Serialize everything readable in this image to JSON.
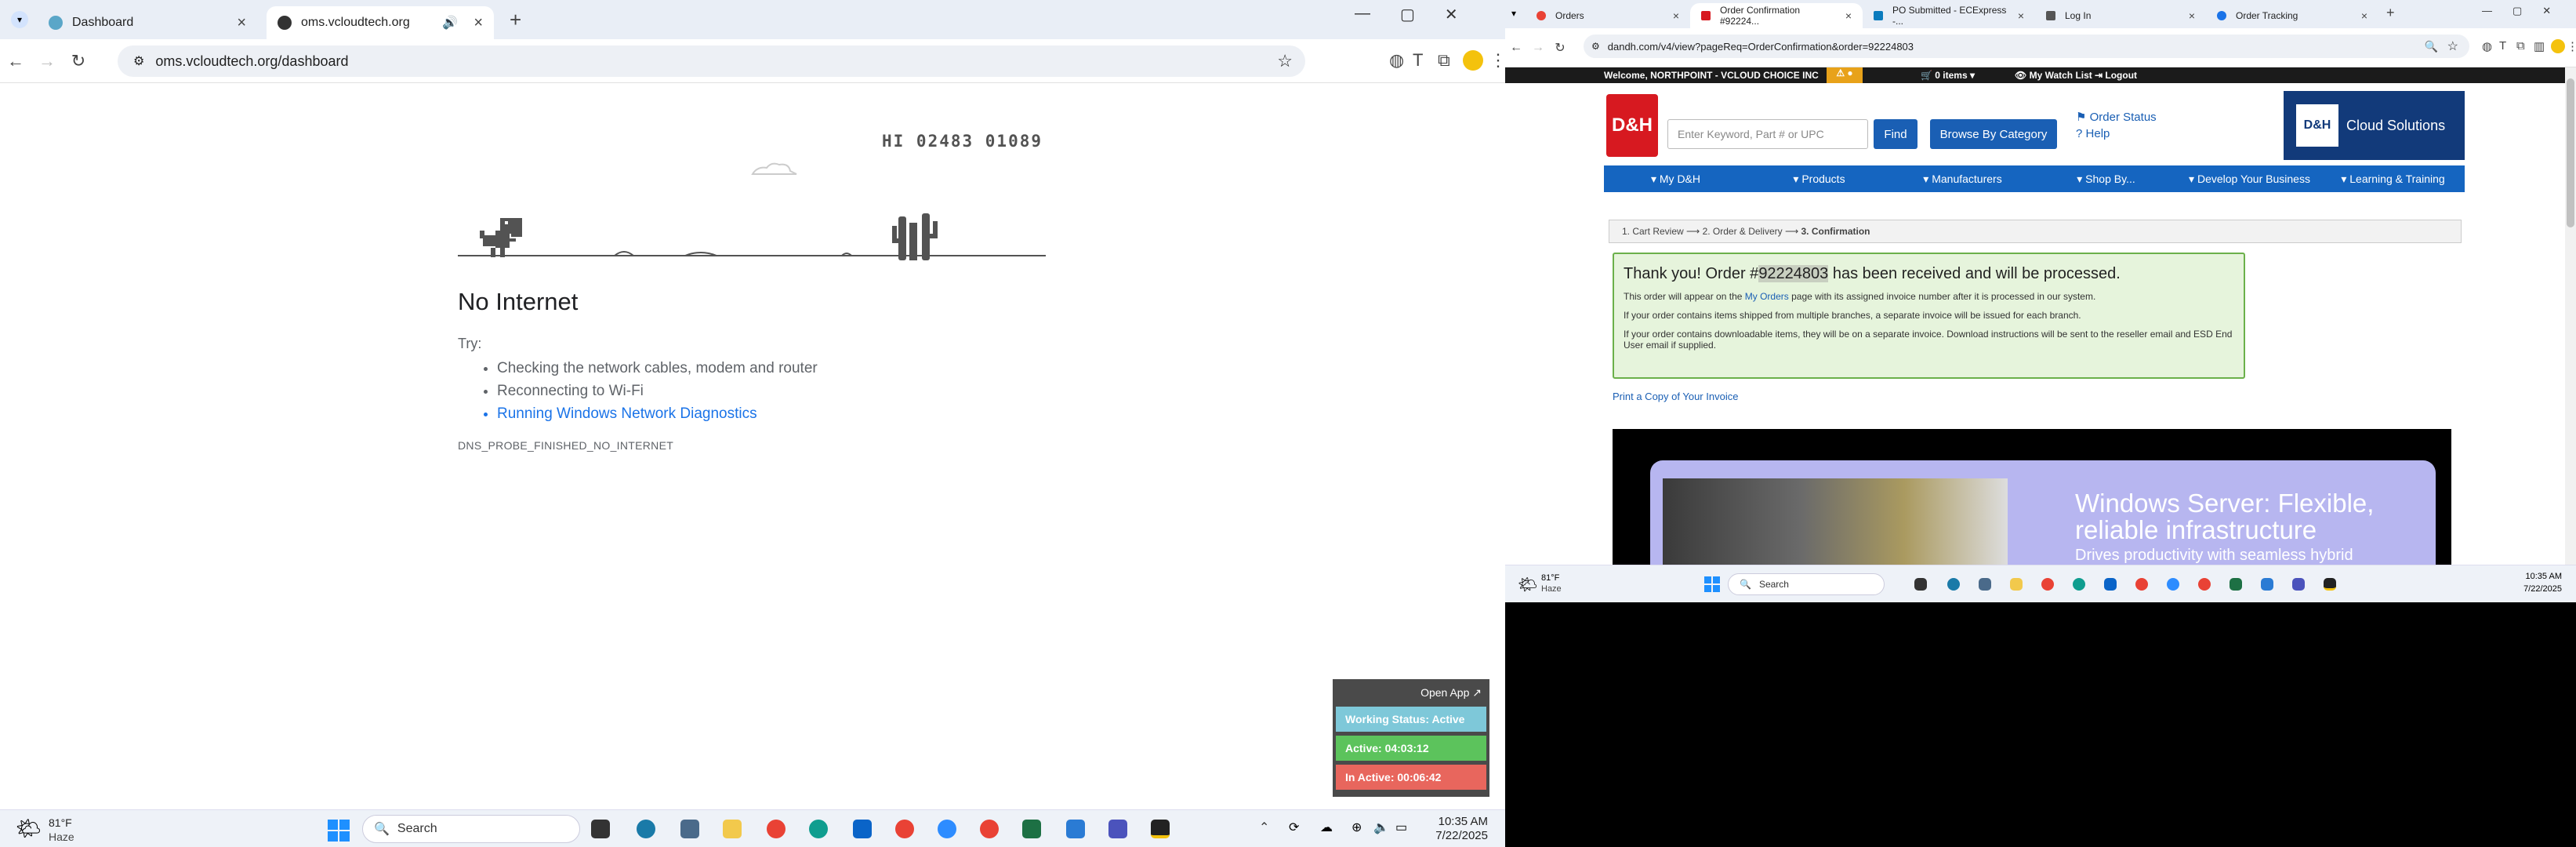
{
  "left_window": {
    "tabs": [
      {
        "label": "Dashboard",
        "active": false
      },
      {
        "label": "oms.vcloudtech.org",
        "active": true
      }
    ],
    "url": "oms.vcloudtech.org/dashboard",
    "dino": {
      "score": "HI 02483 01089"
    },
    "error": {
      "title": "No Internet",
      "try_label": "Try:",
      "tips": [
        "Checking the network cables, modem and router",
        "Reconnecting to Wi-Fi",
        "Running Windows Network Diagnostics"
      ],
      "code": "DNS_PROBE_FINISHED_NO_INTERNET"
    },
    "widget": {
      "open_label": "Open App ↗",
      "status": "Working Status: Active",
      "active": "Active: 04:03:12",
      "inactive": "In Active: 00:06:42",
      "colors": {
        "status": "#7ec8d9",
        "active": "#5cc35c",
        "inactive": "#e8665d"
      }
    }
  },
  "taskbar_left": {
    "weather_temp": "81°F",
    "weather_desc": "Haze",
    "search_label": "Search",
    "time": "10:35 AM",
    "date": "7/22/2025"
  },
  "right_window": {
    "tabs": [
      {
        "label": "Orders"
      },
      {
        "label": "Order Confirmation #92224..."
      },
      {
        "label": "PO Submitted - ECExpress -..."
      },
      {
        "label": "Log In"
      },
      {
        "label": "Order Tracking"
      }
    ],
    "url": "dandh.com/v4/view?pageReq=OrderConfirmation&order=92224803",
    "topbar": {
      "welcome": "Welcome, NORTHPOINT - VCLOUD CHOICE INC",
      "cart": "0 items",
      "watchlist": "My Watch List",
      "logout": "Logout"
    },
    "logo": "D&H",
    "search_placeholder": "Enter Keyword, Part # or UPC",
    "find_label": "Find",
    "browse_label": "Browse By Category",
    "order_status": "Order Status",
    "help": "Help",
    "cloud_logo": "D&H",
    "cloud_label": "Cloud Solutions",
    "nav": [
      "My D&H",
      "Products",
      "Manufacturers",
      "Shop By...",
      "Develop Your Business",
      "Learning & Training"
    ],
    "steps": [
      "1. Cart Review",
      "2. Order & Delivery",
      "3. Confirmation"
    ],
    "confirmation": {
      "thank_prefix": "Thank you! Order #",
      "order_no": "92224803",
      "thank_suffix": " has been received and will be processed.",
      "line1_a": "This order will appear on the ",
      "line1_link": "My Orders",
      "line1_b": " page with its assigned invoice number after it is processed in our system.",
      "line2": "If your order contains items shipped from multiple branches, a separate invoice will be issued for each branch.",
      "line3": "If your order contains downloadable items, they will be on a separate invoice. Download instructions will be sent to the reseller email and ESD End User email if supplied."
    },
    "print_link": "Print a Copy of Your Invoice",
    "banner": {
      "title": "Windows Server: Flexible, reliable infrastructure",
      "subtitle": "Drives productivity with seamless hybrid"
    }
  },
  "taskbar_right": {
    "weather_temp": "81°F",
    "weather_desc": "Haze",
    "search_label": "Search",
    "time": "10:35 AM",
    "date": "7/22/2025"
  }
}
